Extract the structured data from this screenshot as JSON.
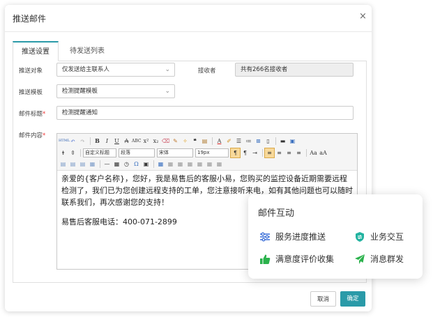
{
  "dialog": {
    "title": "推送邮件",
    "close_glyph": "×",
    "tabs": [
      {
        "label": "推送设置",
        "active": true
      },
      {
        "label": "待发送列表",
        "active": false
      }
    ],
    "form": {
      "push_target": {
        "label": "推送对象",
        "value": "仅发送给主联系人"
      },
      "recipient": {
        "label": "接收者",
        "value": "共有266名接收者"
      },
      "template": {
        "label": "推送模板",
        "value": "检测提醒模板"
      },
      "subject": {
        "label": "邮件标题",
        "required_mark": "*",
        "value": "检测提醒通知"
      },
      "body": {
        "label": "邮件内容",
        "required_mark": "*"
      }
    },
    "editor": {
      "toolbar_row1": [
        "html-icon",
        "undo-icon",
        "redo-icon",
        "bold-icon",
        "italic-icon",
        "underline-icon",
        "strikethrough-icon",
        "abc-icon",
        "superscript-icon",
        "subscript-icon",
        "eraser-icon",
        "brush-icon",
        "format-painter-icon",
        "quote-icon",
        "paste-icon",
        "font-color-icon",
        "highlight-icon",
        "ordered-list-icon",
        "unordered-list-icon",
        "select-all-icon",
        "clear-doc-icon",
        "image-icon"
      ],
      "toolbar_row2": [
        "row-spacing-icon",
        "line-height-icon"
      ],
      "custom_title": "自定义标题",
      "paragraph": "段落",
      "font_family": "宋体",
      "font_size": "19px",
      "paragraphs": [
        "亲爱的{客户名称}，您好，我是易售后的客服小易，您购买的监控设备近期需要远程检测了，我们已为您创建远程支持的工单，您注意接听来电，如有其他问题也可以随时联系我们，再次感谢您的支持！",
        "易售后客服电话：400-071-2899"
      ]
    },
    "buttons": {
      "cancel": "取消",
      "confirm": "确定"
    },
    "accent_color": "#2a9aa8"
  },
  "feature_card": {
    "title": "邮件互动",
    "items": [
      {
        "label": "服务进度推送",
        "icon": "sliders-icon",
        "color": "#3b6fd8"
      },
      {
        "label": "业务交互",
        "icon": "shield-swap-icon",
        "color": "#22b3a0"
      },
      {
        "label": "满意度评价收集",
        "icon": "thumbs-up-icon",
        "color": "#2bb24c"
      },
      {
        "label": "消息群发",
        "icon": "paper-plane-icon",
        "color": "#2bb24c"
      }
    ]
  }
}
